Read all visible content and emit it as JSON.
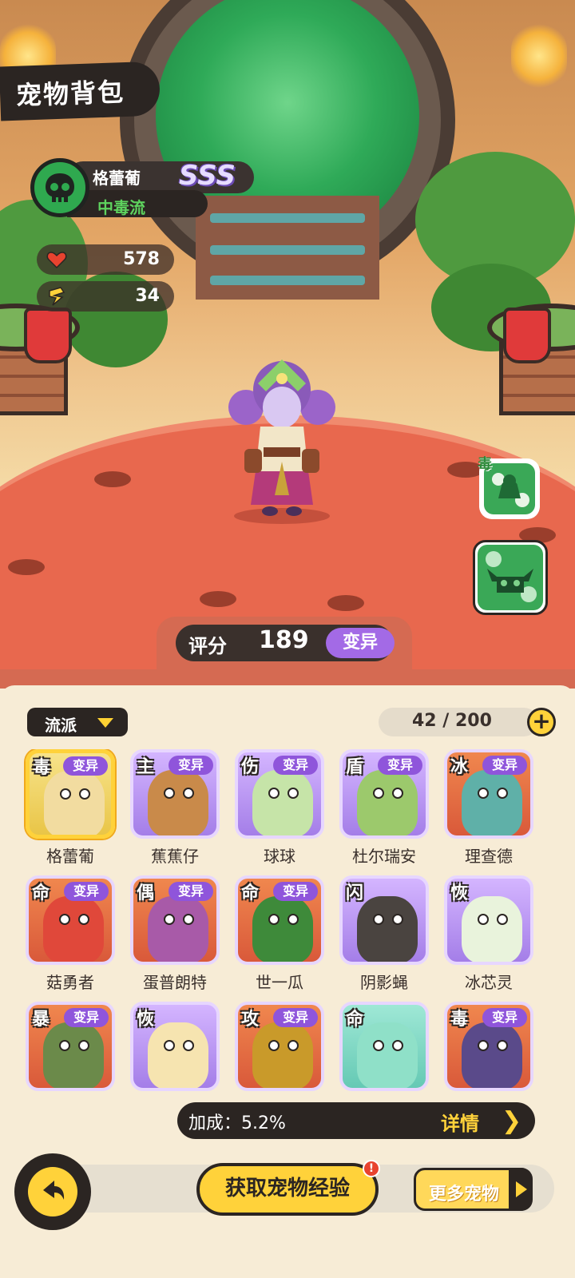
{
  "header": {
    "title": "宠物背包"
  },
  "pet": {
    "name": "格蕾葡",
    "rank": "SSS",
    "style": "中毒流",
    "hp": "578",
    "attack": "34",
    "element_icon": "skull-icon"
  },
  "side": {
    "poison_tag": "毒"
  },
  "score": {
    "label": "评分",
    "value": "189",
    "badge": "变异"
  },
  "inventory": {
    "filter_label": "流派",
    "count": "42 / 200",
    "items": [
      {
        "name": "格蕾葡",
        "element": "毒",
        "mutation": "变异",
        "selected": true,
        "bg": "gold"
      },
      {
        "name": "蕉蕉仔",
        "element": "主",
        "mutation": "变异",
        "bg": "purple"
      },
      {
        "name": "球球",
        "element": "伤",
        "mutation": "变异",
        "bg": "purple"
      },
      {
        "name": "杜尔瑞安",
        "element": "盾",
        "mutation": "变异",
        "bg": "purple"
      },
      {
        "name": "理查德",
        "element": "冰",
        "mutation": "变异",
        "bg": "orange"
      },
      {
        "name": "菇勇者",
        "element": "命",
        "mutation": "变异",
        "bg": "orange"
      },
      {
        "name": "蛋普朗特",
        "element": "偶",
        "mutation": "变异",
        "bg": "orange"
      },
      {
        "name": "世一瓜",
        "element": "命",
        "mutation": "变异",
        "bg": "orange"
      },
      {
        "name": "阴影蝇",
        "element": "闪",
        "mutation": "",
        "bg": "purple"
      },
      {
        "name": "冰芯灵",
        "element": "恢",
        "mutation": "",
        "bg": "purple"
      },
      {
        "name": "",
        "element": "暴",
        "mutation": "变异",
        "bg": "orange"
      },
      {
        "name": "",
        "element": "恢",
        "mutation": "",
        "bg": "purple"
      },
      {
        "name": "",
        "element": "攻",
        "mutation": "变异",
        "bg": "orange"
      },
      {
        "name": "",
        "element": "命",
        "mutation": "",
        "bg": "teal"
      },
      {
        "name": "",
        "element": "毒",
        "mutation": "变异",
        "bg": "orange"
      }
    ]
  },
  "bonus": {
    "text": "加成：5.2%",
    "detail": "详情"
  },
  "footer": {
    "exp_button": "获取宠物经验",
    "exp_alert": "!",
    "more_button": "更多宠物"
  },
  "colors": {
    "accent": "#ffd23a",
    "mutation": "#8f55db",
    "poison": "#2fa94f",
    "dark": "#2b2522"
  }
}
